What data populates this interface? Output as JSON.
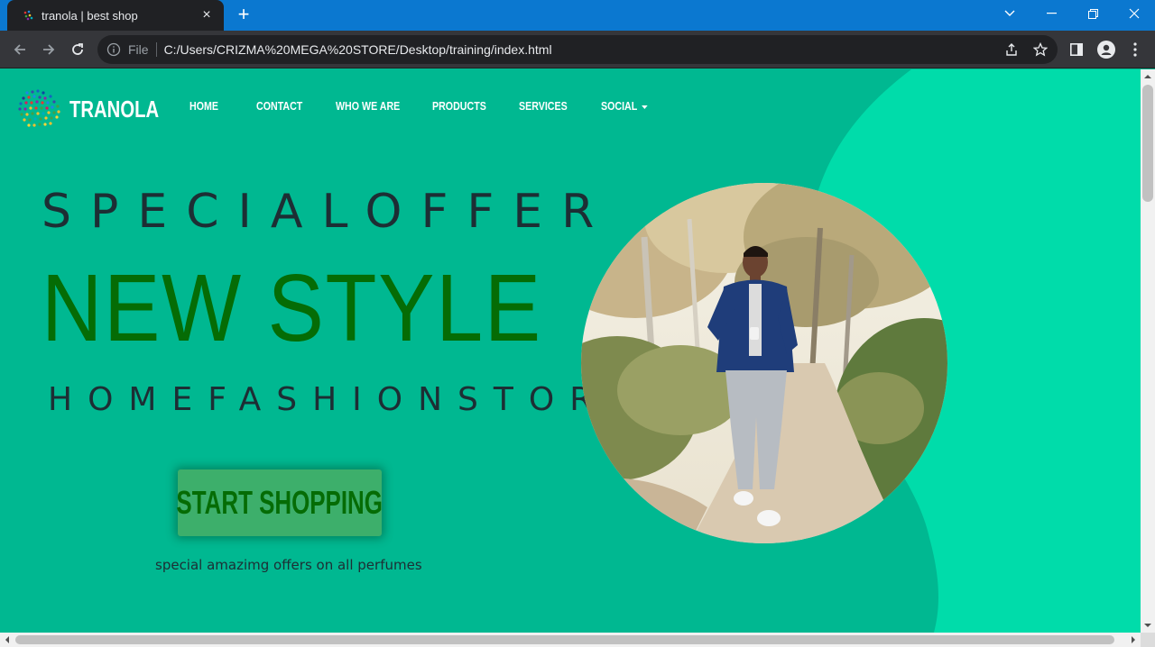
{
  "browser": {
    "tab_title": "tranola | best shop",
    "new_tab_symbol": "+",
    "tab_close_symbol": "×",
    "file_label": "File",
    "url": "C:/Users/CRIZMA%20MEGA%20STORE/Desktop/training/index.html",
    "icons": [
      "favicon",
      "new-tab-icon",
      "back-arrow-icon",
      "forward-arrow-icon",
      "reload-icon",
      "info-icon",
      "share-icon",
      "star-icon",
      "side-panel-icon",
      "profile-icon",
      "more-menu-icon",
      "tab-search-icon",
      "minimize-icon",
      "restore-icon",
      "close-window-icon"
    ],
    "titlebar_color": "#0b78d0",
    "toolbar_color": "#35363a"
  },
  "site": {
    "brand": "TRANOLA",
    "nav": [
      "HOME",
      "CONTACT",
      "WHO WE ARE",
      "PRODUCTS",
      "SERVICES",
      "SOCIAL"
    ],
    "hero": {
      "special_offer": "SPECIALOFFER",
      "headline": "NEW STYLE",
      "subheadline": "HOMEFASHIONSTORE",
      "cta_label": "START SHOPPING",
      "tagline": "special amazimg offers on all perfumes"
    },
    "colors": {
      "background": "#00b891",
      "background_accent": "#00dcaa",
      "headline": "#056c05",
      "text_dark": "#1d2e34",
      "button": "#3daf6b"
    }
  }
}
